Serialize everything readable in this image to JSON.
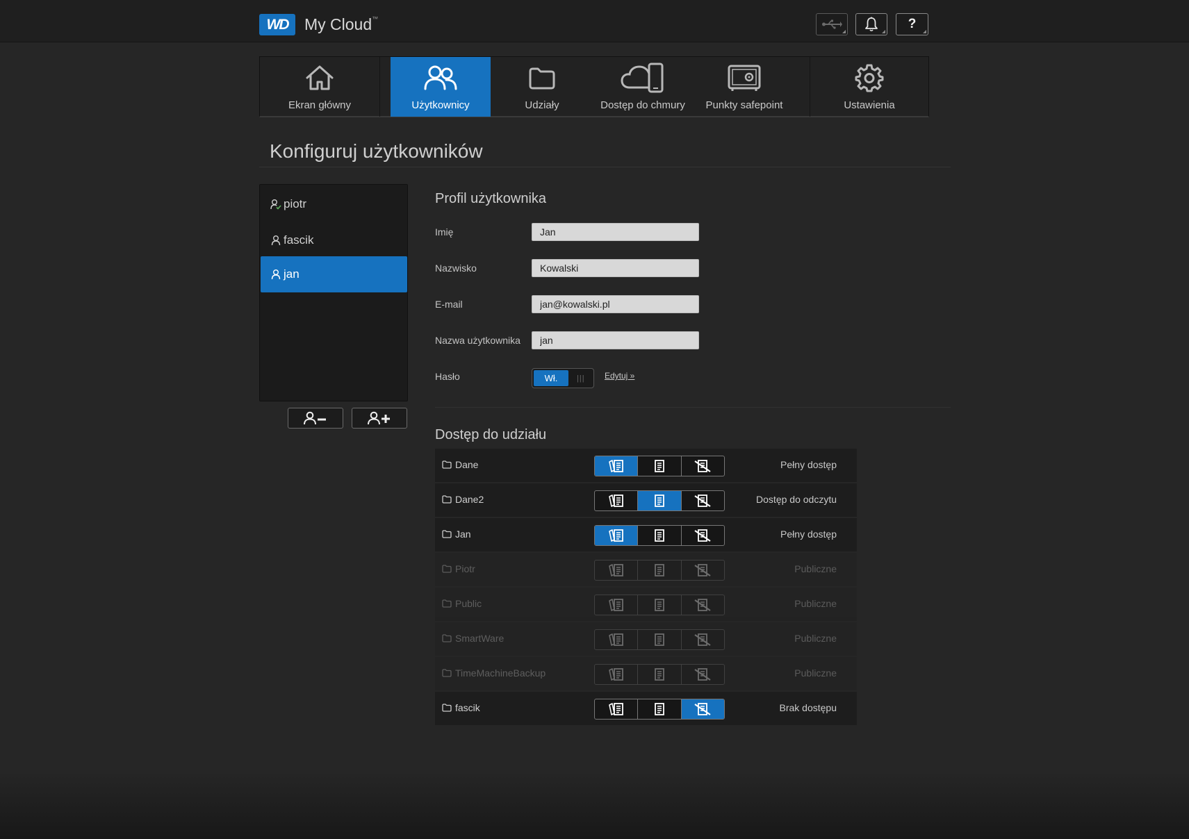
{
  "app": {
    "logo_text": "WD",
    "name": "My Cloud",
    "trademark": "™"
  },
  "topbar": {
    "icons": [
      "usb-icon",
      "bell-icon",
      "help-icon"
    ],
    "help_glyph": "?"
  },
  "nav": {
    "items": [
      {
        "label": "Ekran główny",
        "icon": "home-icon",
        "active": false
      },
      {
        "label": "Użytkownicy",
        "icon": "users-icon",
        "active": true
      },
      {
        "label": "Udziały",
        "icon": "folder-icon",
        "active": false
      },
      {
        "label": "Dostęp do chmury",
        "icon": "cloud-phone-icon",
        "active": false
      },
      {
        "label": "Punkty safepoint",
        "icon": "safe-icon",
        "active": false
      },
      {
        "label": "Ustawienia",
        "icon": "gear-icon",
        "active": false
      }
    ]
  },
  "page_title": "Konfiguruj użytkowników",
  "users": {
    "items": [
      {
        "name": "piotr",
        "selected": false,
        "icon": "user-admin-icon"
      },
      {
        "name": "fascik",
        "selected": false,
        "icon": "user-icon"
      },
      {
        "name": "jan",
        "selected": true,
        "icon": "user-icon"
      }
    ],
    "remove_button_icon": "remove-user-icon",
    "add_button_icon": "add-user-icon"
  },
  "profile": {
    "title": "Profil użytkownika",
    "first_name_label": "Imię",
    "first_name_value": "Jan",
    "last_name_label": "Nazwisko",
    "last_name_value": "Kowalski",
    "email_label": "E-mail",
    "email_value": "jan@kowalski.pl",
    "username_label": "Nazwa użytkownika",
    "username_value": "jan",
    "password_label": "Hasło",
    "password_toggle_label": "Wł.",
    "password_toggle_on": true,
    "edit_link": "Edytuj »"
  },
  "share_access": {
    "title": "Dostęp do udziału",
    "rows": [
      {
        "name": "Dane",
        "access": "full",
        "status": "Pełny dostęp",
        "enabled": true
      },
      {
        "name": "Dane2",
        "access": "read",
        "status": "Dostęp do odczytu",
        "enabled": true
      },
      {
        "name": "Jan",
        "access": "full",
        "status": "Pełny dostęp",
        "enabled": true
      },
      {
        "name": "Piotr",
        "access": "none_selected",
        "status": "Publiczne",
        "enabled": false
      },
      {
        "name": "Public",
        "access": "none_selected",
        "status": "Publiczne",
        "enabled": false
      },
      {
        "name": "SmartWare",
        "access": "none_selected",
        "status": "Publiczne",
        "enabled": false
      },
      {
        "name": "TimeMachineBackup",
        "access": "none_selected",
        "status": "Publiczne",
        "enabled": false
      },
      {
        "name": "fascik",
        "access": "deny",
        "status": "Brak dostępu",
        "enabled": true
      }
    ]
  },
  "colors": {
    "accent": "#1672bf",
    "background": "#262626",
    "panel": "#1b1b1b"
  }
}
